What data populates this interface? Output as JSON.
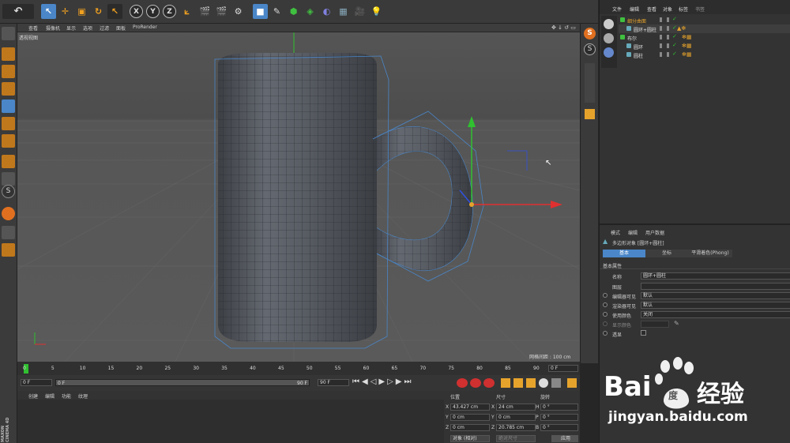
{
  "viewport": {
    "menu": [
      "查看",
      "摄像机",
      "显示",
      "选项",
      "过滤",
      "面板",
      "ProRender"
    ],
    "label": "透视视图",
    "grid_spacing": "网格间距 : 100 cm"
  },
  "timeline": {
    "ticks": [
      "0",
      "5",
      "10",
      "15",
      "20",
      "25",
      "30",
      "35",
      "40",
      "45",
      "50",
      "55",
      "60",
      "65",
      "70",
      "75",
      "80",
      "85",
      "90"
    ],
    "current": "0 F"
  },
  "playbar": {
    "start": "0 F",
    "slider_left": "0 F",
    "slider_right": "90 F",
    "end": "90 F"
  },
  "material_panel": {
    "menu": [
      "创建",
      "编辑",
      "功能",
      "纹理"
    ]
  },
  "coord_panel": {
    "headers": [
      "位置",
      "尺寸",
      "旋转"
    ],
    "rows": [
      {
        "axis": "X",
        "pos": "43.427 cm",
        "size_axis": "X",
        "size": "24 cm",
        "rot_axis": "H",
        "rot": "0 °"
      },
      {
        "axis": "Y",
        "pos": "0 cm",
        "size_axis": "Y",
        "size": "0 cm",
        "rot_axis": "P",
        "rot": "0 °"
      },
      {
        "axis": "Z",
        "pos": "0 cm",
        "size_axis": "Z",
        "size": "20.785 cm",
        "rot_axis": "B",
        "rot": "0 °"
      }
    ],
    "mode": "对象 (相对)",
    "size_mode": "绝对尺寸",
    "apply": "应用"
  },
  "object_manager": {
    "menu": [
      "文件",
      "编辑",
      "查看",
      "对象",
      "标签",
      "书签"
    ],
    "objects": [
      {
        "name": "细分曲面",
        "level": 0,
        "color": "#e6a32c"
      },
      {
        "name": "圆环+圆柱",
        "level": 1,
        "color": "#e0e0e0"
      },
      {
        "name": "布尔",
        "level": 0,
        "color": "#e0e0e0"
      },
      {
        "name": "圆环",
        "level": 1,
        "color": "#e0e0e0"
      },
      {
        "name": "圆柱",
        "level": 1,
        "color": "#e0e0e0"
      }
    ]
  },
  "attributes": {
    "menu": [
      "模式",
      "编辑",
      "用户数据"
    ],
    "object_title": "多边形对象 [圆环+圆柱]",
    "tabs": [
      "基本",
      "坐标",
      "平滑着色(Phong)"
    ],
    "section": "基本属性",
    "fields": [
      {
        "label": "名称",
        "value": "圆环+圆柱"
      },
      {
        "label": "图层",
        "value": ""
      },
      {
        "label": "编辑器可见",
        "value": "默认"
      },
      {
        "label": "渲染器可见",
        "value": "默认"
      },
      {
        "label": "使用颜色",
        "value": "关闭"
      },
      {
        "label": "显示颜色",
        "value": ""
      },
      {
        "label": "透显",
        "value": ""
      }
    ]
  },
  "branding": {
    "side_logo": "MAXON CINEMA 4D",
    "watermark_main": "Bai",
    "watermark_du": "度",
    "watermark_cn": "经验",
    "watermark_url": "jingyan.baidu.com"
  },
  "colors": {
    "accent_orange": "#e6a32c",
    "selection_blue": "#4a86c8",
    "axis_red": "#e03030",
    "axis_green": "#30c030",
    "axis_blue": "#3050e0"
  }
}
